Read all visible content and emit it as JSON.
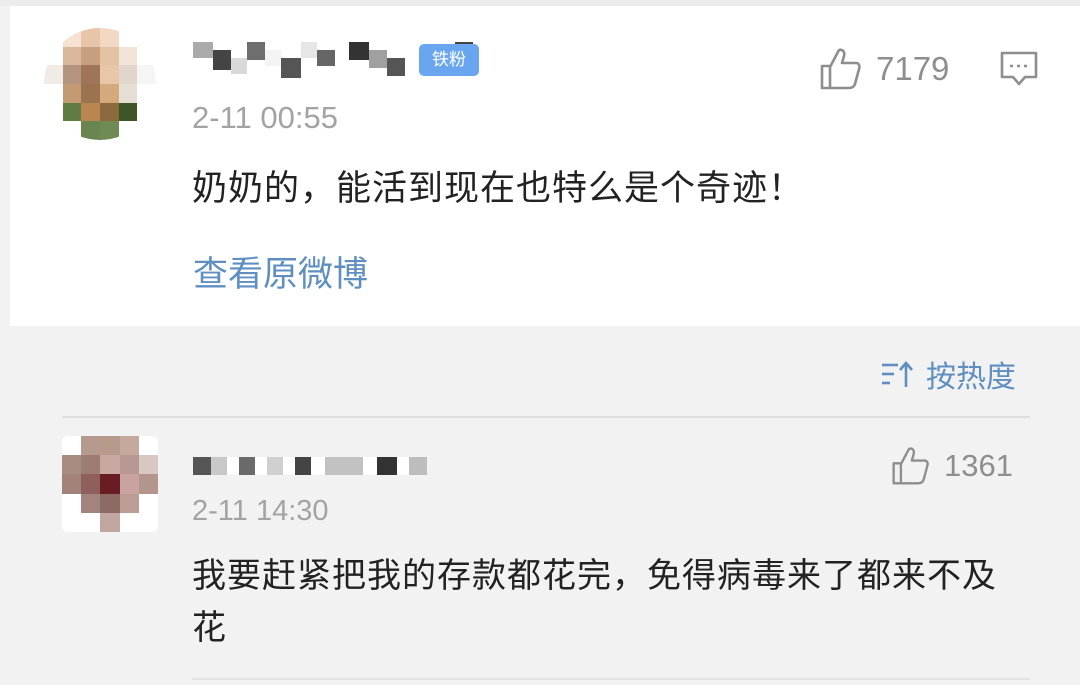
{
  "main_comment": {
    "badge": "铁粉",
    "time": "2-11 00:55",
    "text": "奶奶的，能活到现在也特么是个奇迹！",
    "likes": "7179",
    "view_original": "查看原微博"
  },
  "sort": {
    "label": "按热度"
  },
  "reply": {
    "time": "2-11 14:30",
    "text": "我要赶紧把我的存款都花完，免得病毒来了都来不及花",
    "likes": "1361"
  }
}
